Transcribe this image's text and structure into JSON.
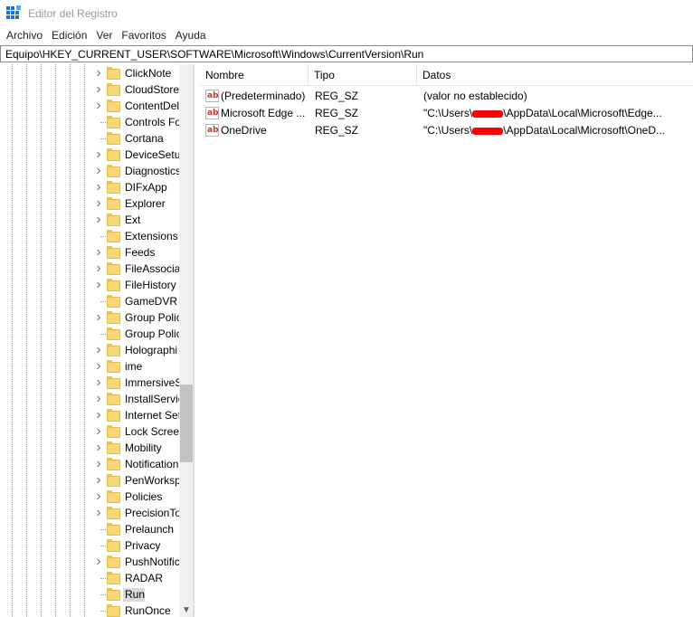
{
  "window": {
    "title": "Editor del Registro"
  },
  "menu": [
    "Archivo",
    "Edición",
    "Ver",
    "Favoritos",
    "Ayuda"
  ],
  "address": "Equipo\\HKEY_CURRENT_USER\\SOFTWARE\\Microsoft\\Windows\\CurrentVersion\\Run",
  "tree": {
    "items": [
      {
        "label": "ClickNote",
        "expandable": true
      },
      {
        "label": "CloudStore",
        "expandable": true
      },
      {
        "label": "ContentDel",
        "expandable": true
      },
      {
        "label": "Controls Fo",
        "expandable": false
      },
      {
        "label": "Cortana",
        "expandable": false
      },
      {
        "label": "DeviceSetu",
        "expandable": true
      },
      {
        "label": "Diagnostics",
        "expandable": true
      },
      {
        "label": "DIFxApp",
        "expandable": true
      },
      {
        "label": "Explorer",
        "expandable": true
      },
      {
        "label": "Ext",
        "expandable": true
      },
      {
        "label": "Extensions",
        "expandable": false
      },
      {
        "label": "Feeds",
        "expandable": true
      },
      {
        "label": "FileAssocia",
        "expandable": true
      },
      {
        "label": "FileHistory",
        "expandable": true
      },
      {
        "label": "GameDVR",
        "expandable": false
      },
      {
        "label": "Group Polic",
        "expandable": true
      },
      {
        "label": "Group Polic",
        "expandable": false
      },
      {
        "label": "Holographi",
        "expandable": true
      },
      {
        "label": "ime",
        "expandable": true
      },
      {
        "label": "ImmersiveS",
        "expandable": true
      },
      {
        "label": "InstallServic",
        "expandable": true
      },
      {
        "label": "Internet Set",
        "expandable": true
      },
      {
        "label": "Lock Screen",
        "expandable": true
      },
      {
        "label": "Mobility",
        "expandable": true
      },
      {
        "label": "Notification",
        "expandable": true
      },
      {
        "label": "PenWorksp",
        "expandable": true
      },
      {
        "label": "Policies",
        "expandable": true
      },
      {
        "label": "PrecisionTo",
        "expandable": true
      },
      {
        "label": "Prelaunch",
        "expandable": false
      },
      {
        "label": "Privacy",
        "expandable": false
      },
      {
        "label": "PushNotific",
        "expandable": true
      },
      {
        "label": "RADAR",
        "expandable": false
      },
      {
        "label": "Run",
        "expandable": false,
        "selected": true
      },
      {
        "label": "RunOnce",
        "expandable": false
      }
    ]
  },
  "values": {
    "columns": [
      "Nombre",
      "Tipo",
      "Datos"
    ],
    "rows": [
      {
        "name": "(Predeterminado)",
        "type": "REG_SZ",
        "data_pre": "(valor no establecido)",
        "data_post": "",
        "redacted": false
      },
      {
        "name": "Microsoft Edge ...",
        "type": "REG_SZ",
        "data_pre": "\"C:\\Users\\",
        "data_post": "\\AppData\\Local\\Microsoft\\Edge...",
        "redacted": true
      },
      {
        "name": "OneDrive",
        "type": "REG_SZ",
        "data_pre": "\"C:\\Users\\",
        "data_post": "\\AppData\\Local\\Microsoft\\OneD...",
        "redacted": true
      }
    ]
  },
  "colors": {
    "selection": "#d9d9d9",
    "folder": "#f6d77a",
    "redaction": "#ff0000",
    "icon_accent": "#c0392b"
  }
}
